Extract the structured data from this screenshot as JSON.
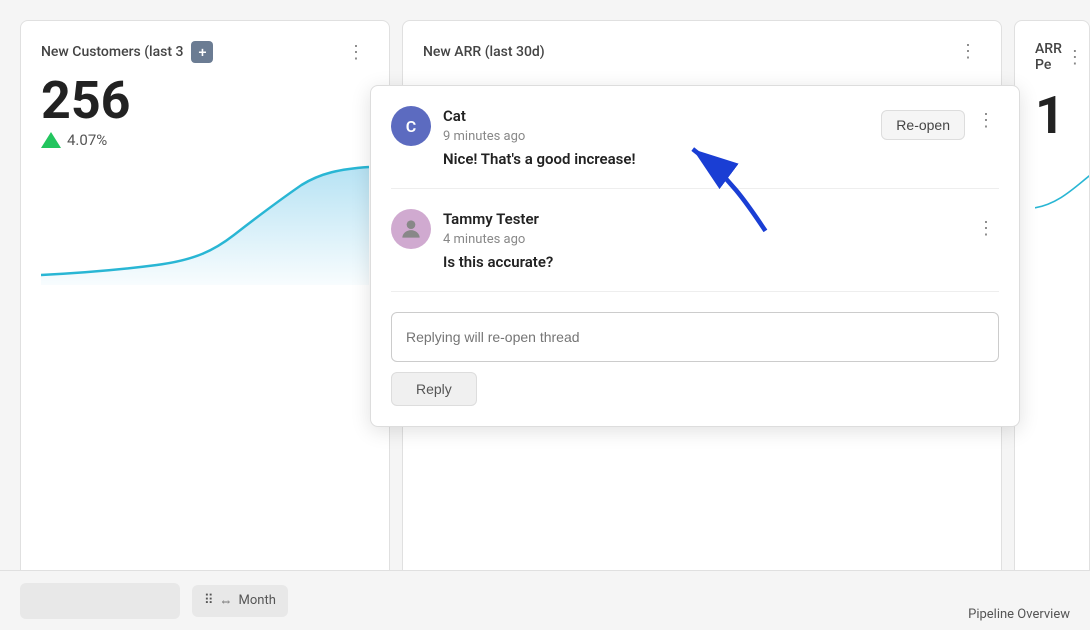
{
  "cards": {
    "left": {
      "title": "New Customers (last 3",
      "value": "256",
      "change": "4.07%",
      "add_label": "+",
      "dots_label": "⋮"
    },
    "middle": {
      "title": "New ARR (last 30d)",
      "dots_label": "⋮"
    },
    "right": {
      "title": "ARR Pe",
      "value": "1",
      "dots_label": "⋮"
    }
  },
  "bottom_bar": {
    "month_label": "Month"
  },
  "comment_popup": {
    "comment1": {
      "author": "Cat",
      "avatar_letter": "C",
      "time": "9 minutes ago",
      "text": "Nice! That's a good increase!",
      "reopen_label": "Re-open",
      "dots_label": "⋮"
    },
    "comment2": {
      "author": "Tammy Tester",
      "time": "4 minutes ago",
      "text": "Is this accurate?",
      "dots_label": "⋮"
    },
    "reply_input_placeholder": "Replying will re-open thread",
    "reply_button_label": "Reply"
  },
  "pipeline_text": "Pipeline Overview"
}
